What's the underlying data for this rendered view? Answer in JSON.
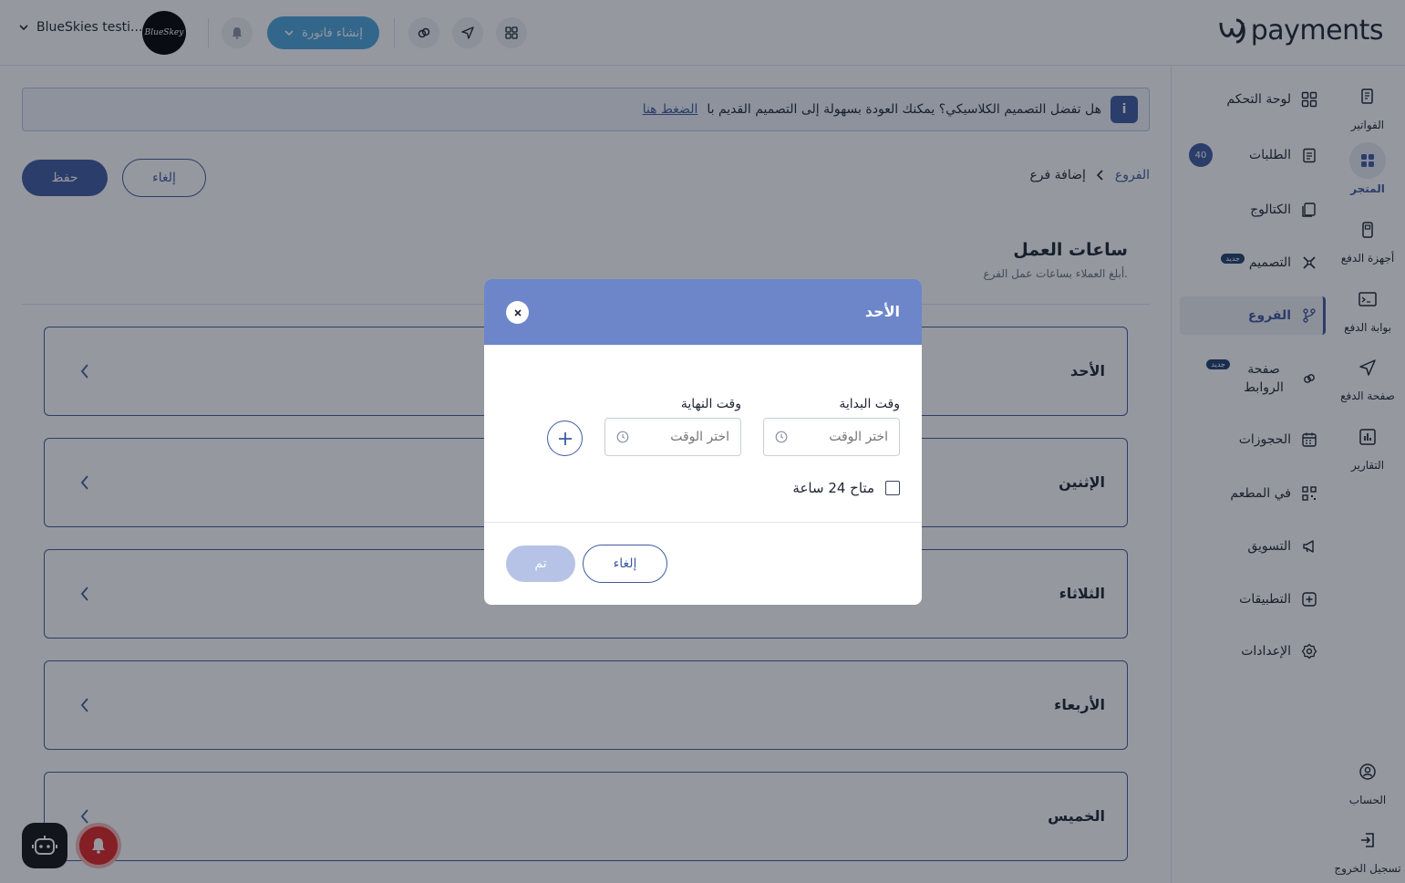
{
  "header": {
    "logo_text": "payments",
    "store_name": "BlueSkies testi...",
    "avatar_text": "BlueSkey",
    "create_invoice_label": "إنشاء فاتورة",
    "accent_color": "#3e5aa0",
    "invoice_button_color": "#4ea5dd"
  },
  "rail": {
    "items": [
      {
        "label": "الفواتير",
        "icon": "invoice-icon"
      },
      {
        "label": "المتجر",
        "icon": "store-icon",
        "active": true
      },
      {
        "label": "أجهزة الدفع",
        "icon": "pos-device-icon"
      },
      {
        "label": "بوابة الدفع",
        "icon": "payment-gateway-icon"
      },
      {
        "label": "صفحة الدفع",
        "icon": "send-icon"
      },
      {
        "label": "التقارير",
        "icon": "reports-icon"
      }
    ],
    "account_label": "الحساب",
    "logout_label": "تسجيل الخروج"
  },
  "menu": {
    "items": [
      {
        "label": "لوحة التحكم",
        "icon": "dashboard-icon"
      },
      {
        "label": "الطلبات",
        "icon": "orders-icon",
        "badge": "40"
      },
      {
        "label": "الكتالوج",
        "icon": "catalog-icon"
      },
      {
        "label": "التصميم",
        "icon": "design-icon",
        "new_badge": "جديد"
      },
      {
        "label": "الفروع",
        "icon": "branches-icon",
        "active": true
      },
      {
        "label": "صفحة الروابط",
        "icon": "links-icon",
        "new_badge": "جديد"
      },
      {
        "label": "الحجوزات",
        "icon": "calendar-icon"
      },
      {
        "label": "في المطعم",
        "icon": "qr-icon"
      },
      {
        "label": "التسويق",
        "icon": "megaphone-icon"
      },
      {
        "label": "التطبيقات",
        "icon": "apps-icon"
      },
      {
        "label": "الإعدادات",
        "icon": "settings-icon"
      }
    ]
  },
  "banner": {
    "text": "هل تفضل التصميم الكلاسيكي؟ يمكنك العودة بسهولة إلى التصميم القديم با",
    "link": "الضغط هنا"
  },
  "page": {
    "save_label": "حفظ",
    "cancel_label": "إلغاء",
    "breadcrumb": [
      "الفروع",
      "إضافة فرع"
    ],
    "section_title": "ساعات العمل",
    "section_subtitle": "أبلغ العملاء بساعات عمل الفرع.",
    "days": [
      "الأحد",
      "الإثنين",
      "الثلاثاء",
      "الأربعاء",
      "الخميس"
    ]
  },
  "modal": {
    "title": "الأحد",
    "start_label": "وقت البداية",
    "end_label": "وقت النهاية",
    "time_placeholder": "اختر الوقت",
    "all_day_label": "متاح 24 ساعة",
    "all_day_checked": false,
    "done_label": "تم",
    "cancel_label": "إلغاء"
  }
}
